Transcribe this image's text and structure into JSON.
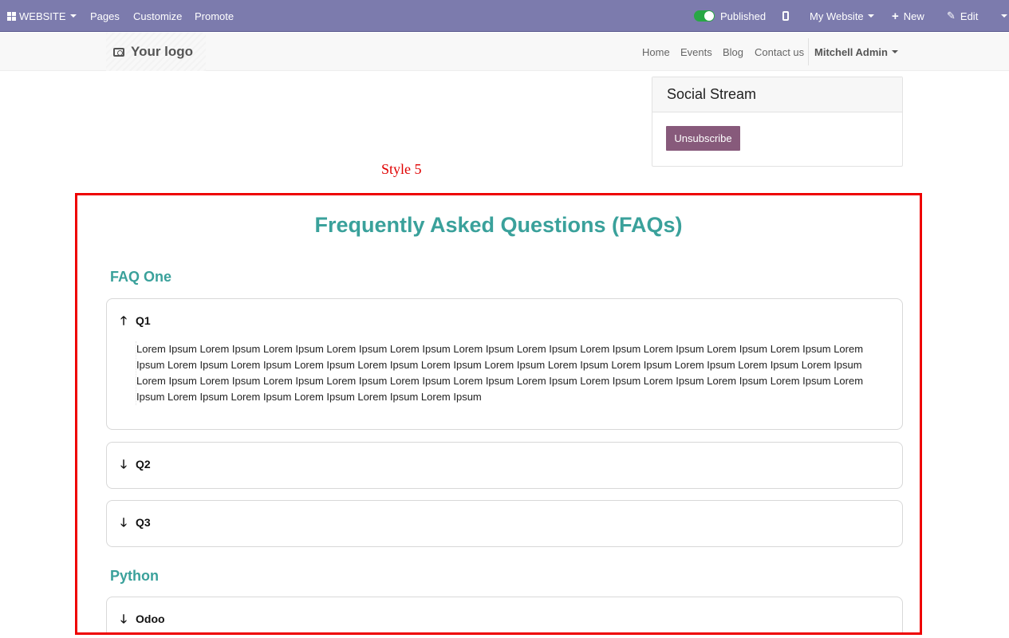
{
  "adminbar": {
    "website_label": "WEBSITE",
    "pages_label": "Pages",
    "customize_label": "Customize",
    "promote_label": "Promote",
    "published_label": "Published",
    "my_website_label": "My Website",
    "new_label": "New",
    "edit_label": "Edit",
    "accent_color": "#7c7bad"
  },
  "sitenav": {
    "logo_text": "Your logo",
    "links": [
      "Home",
      "Events",
      "Blog",
      "Contact us"
    ],
    "user_name": "Mitchell Admin"
  },
  "social": {
    "title": "Social Stream",
    "button_label": "Unsubscribe",
    "button_color": "#875a7b"
  },
  "style_label": "Style 5",
  "faq": {
    "title": "Frequently Asked Questions (FAQs)",
    "accent_color": "#3aa19b",
    "frame_color": "#ee0000",
    "sections": [
      {
        "title": "FAQ One",
        "items": [
          {
            "question": "Q1",
            "expanded": true,
            "icon": "arrow-up-icon",
            "answer": "Lorem Ipsum Lorem Ipsum Lorem Ipsum Lorem Ipsum Lorem Ipsum Lorem Ipsum Lorem Ipsum Lorem Ipsum Lorem Ipsum Lorem Ipsum Lorem Ipsum Lorem Ipsum Lorem Ipsum Lorem Ipsum Lorem Ipsum Lorem Ipsum Lorem Ipsum Lorem Ipsum Lorem Ipsum Lorem Ipsum Lorem Ipsum Lorem Ipsum Lorem Ipsum Lorem Ipsum Lorem Ipsum Lorem Ipsum Lorem Ipsum Lorem Ipsum Lorem Ipsum Lorem Ipsum Lorem Ipsum Lorem Ipsum Lorem Ipsum Lorem Ipsum Lorem Ipsum Lorem Ipsum Lorem Ipsum Lorem Ipsum Lorem Ipsum Lorem Ipsum"
          },
          {
            "question": "Q2",
            "expanded": false,
            "icon": "arrow-down-icon"
          },
          {
            "question": "Q3",
            "expanded": false,
            "icon": "arrow-down-icon"
          }
        ]
      },
      {
        "title": "Python",
        "items": [
          {
            "question": "Odoo",
            "expanded": false,
            "icon": "arrow-down-icon"
          }
        ]
      }
    ]
  }
}
